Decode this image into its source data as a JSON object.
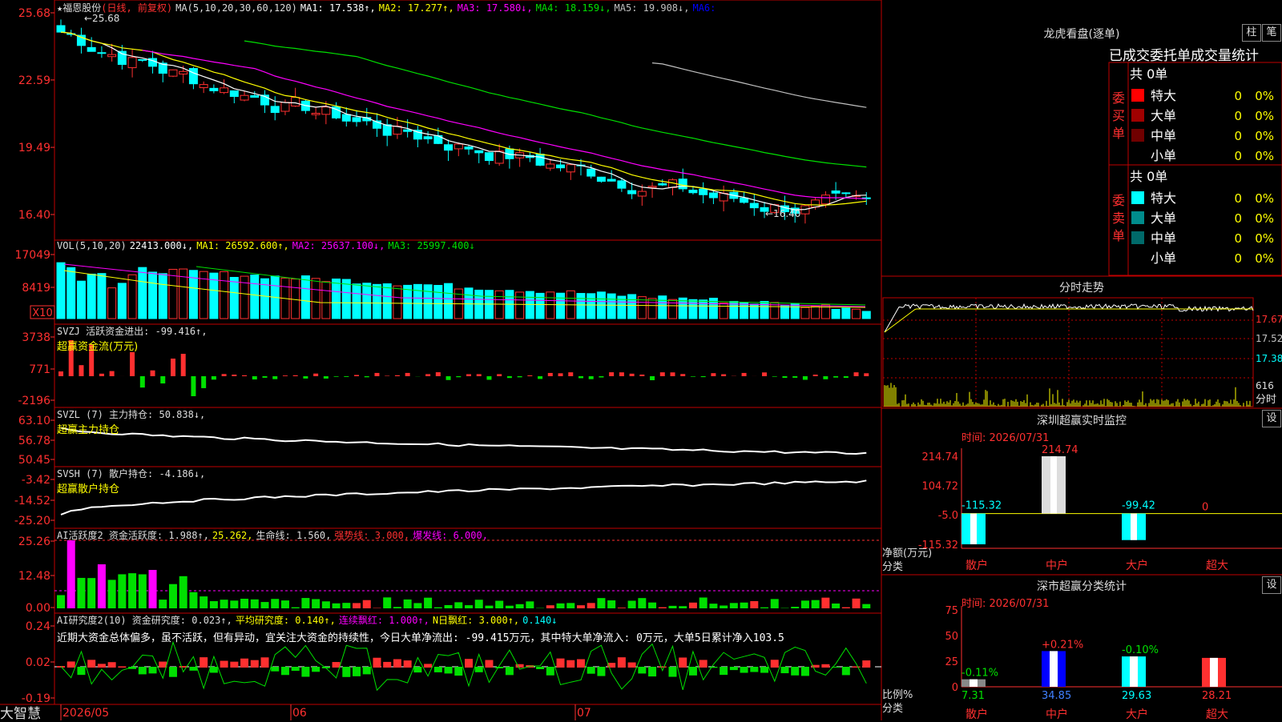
{
  "colors": {
    "up": "#ff3030",
    "down": "#00ffff",
    "ma1": "#ffffff",
    "ma2": "#ffff00",
    "ma3": "#ff00ff",
    "ma4": "#00e000",
    "ma5": "#c0c0c0",
    "grid": "#c00000",
    "text_red": "#ff3030",
    "yellow": "#ffff00",
    "green": "#00e000",
    "magenta": "#ff00ff"
  },
  "app": {
    "brand": "大智慧"
  },
  "price_panel": {
    "stock": "★福恩股份",
    "mode": "(日线, 前复权)",
    "ma_def": "MA(5,10,20,30,60,120)",
    "ma": [
      {
        "label": "MA1: 17.538↑,",
        "color": "#ffffff"
      },
      {
        "label": "MA2: 17.277↑,",
        "color": "#ffff00"
      },
      {
        "label": "MA3: 17.580↓,",
        "color": "#ff00ff"
      },
      {
        "label": "MA4: 18.159↓,",
        "color": "#00e000"
      },
      {
        "label": "MA5: 19.908↓,",
        "color": "#c0c0c0"
      },
      {
        "label": "MA6:",
        "color": "#0000ff"
      }
    ],
    "yticks": [
      "25.68",
      "22.59",
      "19.49",
      "16.40"
    ],
    "high_label": "25.68",
    "low_label": "16.40"
  },
  "vol_panel": {
    "def": "VOL(5,10,20)",
    "value": "22413.000↓,",
    "ma1": "MA1: 26592.600↑,",
    "ma2": "MA2: 25637.100↓,",
    "ma3": "MA3: 25997.400↓",
    "yticks": [
      "17049",
      "8419"
    ],
    "unit": "X10"
  },
  "svzj_panel": {
    "def": "SVZJ  活跃资金进出: -99.416↑,",
    "subtitle": "超赢资金流(万元)",
    "yticks": [
      "3738",
      "771",
      "-2196"
    ]
  },
  "svzl_panel": {
    "def": "SVZL (7) 主力持仓: 50.838↓,",
    "subtitle": "超赢主力持仓",
    "yticks": [
      "63.10",
      "56.78",
      "50.45"
    ]
  },
  "svsh_panel": {
    "def": "SVSH (7) 散户持仓: -4.186↓,",
    "subtitle": "超赢散户持仓",
    "yticks": [
      "-3.42",
      "-14.52",
      "-25.20"
    ]
  },
  "ai_panel": {
    "def": "AI活跃度2 资金活跃度: 1.988↑,",
    "v2": "25.262,",
    "v3": "生命线: 1.560,",
    "v4": "强势线: 3.000,",
    "v5": "爆发线: 6.000,",
    "yticks": [
      "25.26",
      "12.48",
      "0.00"
    ]
  },
  "ai2_panel": {
    "def": "AI研究度2(10) 资金研究度: 0.023↑,",
    "v2": "平均研究度: 0.140↑,",
    "v3": "连续飘红: 1.000↑,",
    "v4": "N日飘红: 3.000↑,",
    "v5": "0.140↓",
    "comment": "近期大资金总体偏多，虽不活跃，但有异动，宜关注大资金的持续性，今日大单净流出: -99.415万元，其中特大单净流入: 0万元，大单5日累计净入103.5",
    "yticks": [
      "0.24",
      "0.02",
      "-0.19"
    ]
  },
  "xaxis": [
    "2026/05",
    "06",
    "07"
  ],
  "lhb": {
    "title": "龙虎看盘(逐单)",
    "btn1": "柱",
    "btn2": "笔",
    "subtitle": "已成交委托单成交量统计",
    "buy": {
      "label": "委买单",
      "total": "共 0单",
      "rows": [
        {
          "name": "特大",
          "vol": "0",
          "pct": "0%",
          "color": "#ff0000"
        },
        {
          "name": "大单",
          "vol": "0",
          "pct": "0%",
          "color": "#a00000"
        },
        {
          "name": "中单",
          "vol": "0",
          "pct": "0%",
          "color": "#700000"
        },
        {
          "name": "小单",
          "vol": "0",
          "pct": "0%",
          "color": "#000000"
        }
      ]
    },
    "sell": {
      "label": "委卖单",
      "total": "共 0单",
      "rows": [
        {
          "name": "特大",
          "vol": "0",
          "pct": "0%",
          "color": "#00ffff"
        },
        {
          "name": "大单",
          "vol": "0",
          "pct": "0%",
          "color": "#008c8c"
        },
        {
          "name": "中单",
          "vol": "0",
          "pct": "0%",
          "color": "#006a6a"
        },
        {
          "name": "小单",
          "vol": "0",
          "pct": "0%",
          "color": "#000000"
        }
      ]
    }
  },
  "fenshi": {
    "title": "分时走势",
    "yticks": [
      "17.67",
      "17.52",
      "17.38"
    ],
    "vol_tick": "616",
    "vol_unit": "分时"
  },
  "sz_monitor": {
    "title": "深圳超赢实时监控",
    "btn": "设",
    "date": "时间: 2026/07/31",
    "yticks": [
      "214.74",
      "104.72",
      "-5.0",
      "-115.32"
    ],
    "ylabel": "净额(万元)",
    "xlabel": "分类",
    "cats": [
      "散户",
      "中户",
      "大户",
      "超大"
    ],
    "values": [
      -115.32,
      214.74,
      -99.42,
      0
    ],
    "labels": [
      "-115.32",
      "214.74",
      "-99.42",
      "0"
    ]
  },
  "sz_class": {
    "title": "深市超赢分类统计",
    "btn": "设",
    "date": "时间: 2026/07/31",
    "yticks": [
      "75",
      "50",
      "25",
      "0"
    ],
    "ylabel": "比例%",
    "xlabel": "分类",
    "cats": [
      "散户",
      "中户",
      "大户",
      "超大"
    ],
    "values": [
      7.31,
      34.85,
      29.63,
      28.21
    ],
    "labels": [
      "7.31",
      "34.85",
      "29.63",
      "28.21"
    ],
    "changes": [
      "-0.11%",
      "+0.21%",
      "-0.10%",
      ""
    ]
  }
}
